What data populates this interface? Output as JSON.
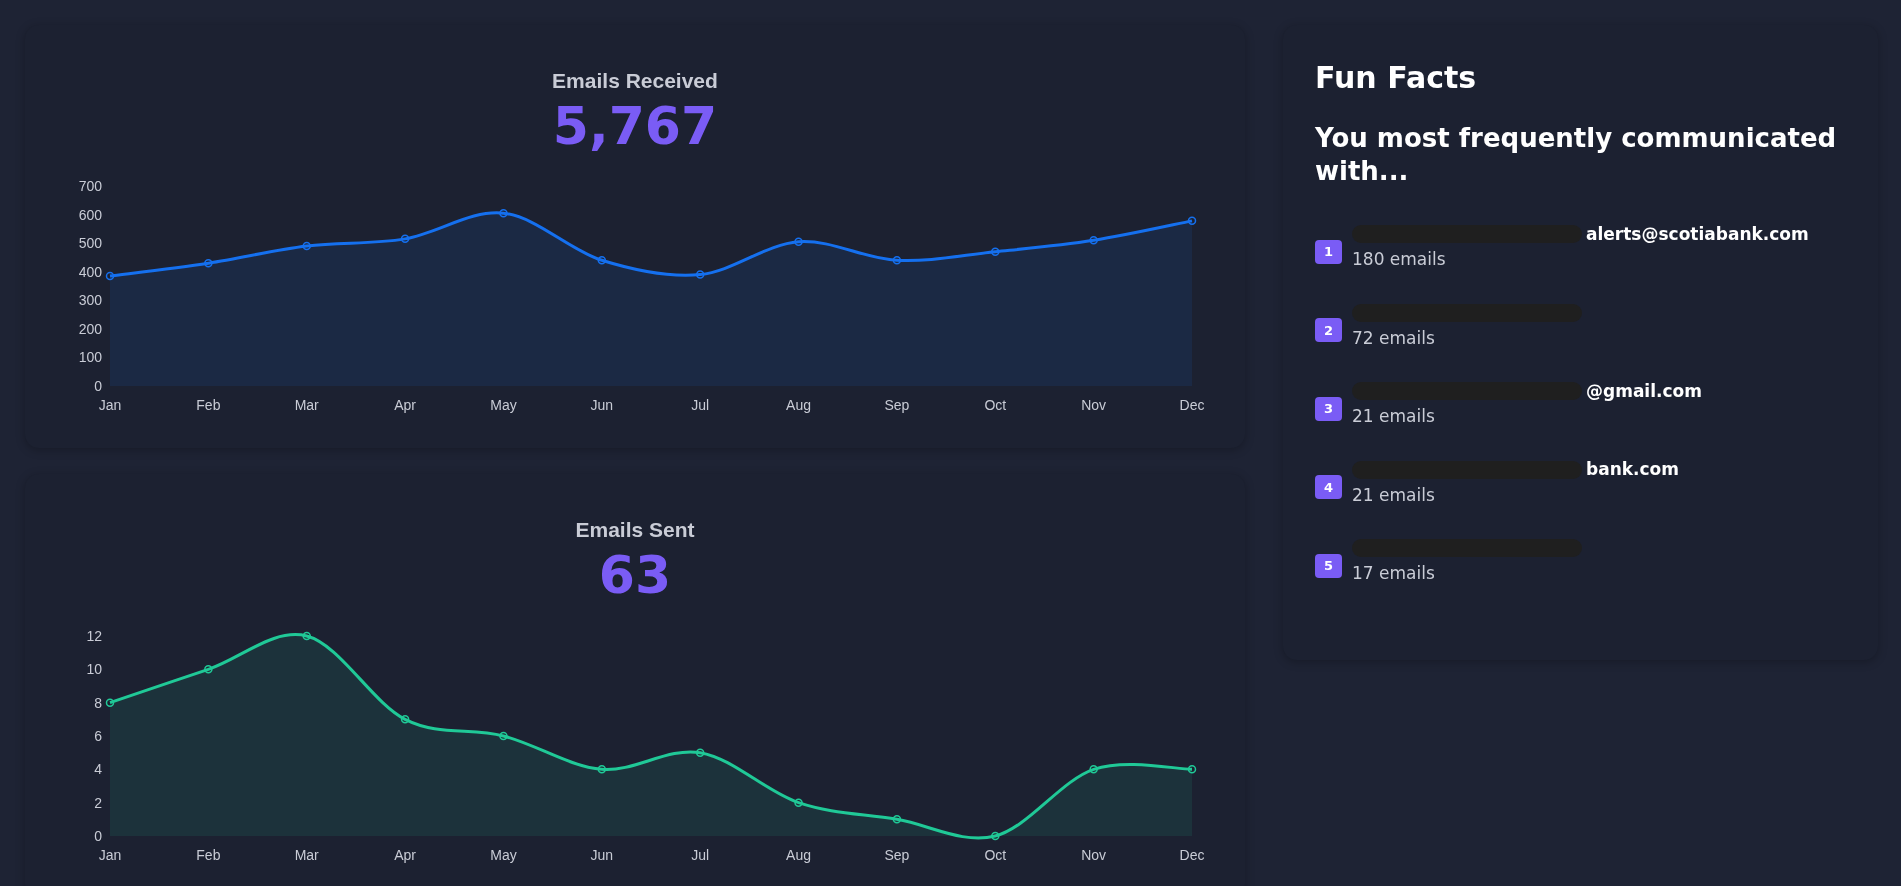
{
  "received": {
    "title": "Emails Received",
    "total": "5,767",
    "chart_data": {
      "type": "area",
      "categories": [
        "Jan",
        "Feb",
        "Mar",
        "Apr",
        "May",
        "Jun",
        "Jul",
        "Aug",
        "Sep",
        "Oct",
        "Nov",
        "Dec"
      ],
      "ylim": [
        0,
        700
      ],
      "yticks": [
        0,
        100,
        200,
        300,
        400,
        500,
        600,
        700
      ],
      "series": [
        {
          "color": "#1570ef",
          "values": [
            385,
            430,
            490,
            515,
            605,
            440,
            390,
            505,
            440,
            470,
            510,
            578
          ]
        }
      ]
    }
  },
  "sent": {
    "title": "Emails Sent",
    "total": "63",
    "chart_data": {
      "type": "area",
      "categories": [
        "Jan",
        "Feb",
        "Mar",
        "Apr",
        "May",
        "Jun",
        "Jul",
        "Aug",
        "Sep",
        "Oct",
        "Nov",
        "Dec"
      ],
      "ylim": [
        0,
        12
      ],
      "yticks": [
        0,
        2,
        4,
        6,
        8,
        10,
        12
      ],
      "series": [
        {
          "color": "#20c997",
          "values": [
            8,
            10,
            12,
            7,
            6,
            4,
            5,
            2,
            1,
            0,
            4,
            4
          ]
        }
      ]
    }
  },
  "fun_facts": {
    "title": "Fun Facts",
    "subtitle": "You most frequently communicated with...",
    "contacts": [
      {
        "rank": "1",
        "address": "alerts@scotiabank.com",
        "count": "180 emails",
        "redacted": true
      },
      {
        "rank": "2",
        "count": "72 emails",
        "redacted": true
      },
      {
        "rank": "3",
        "address": "@gmail.com",
        "count": "21 emails",
        "redacted": true
      },
      {
        "rank": "4",
        "address": "bank.com",
        "count": "21 emails",
        "redacted": true
      },
      {
        "rank": "5",
        "count": "17 emails",
        "redacted": true
      }
    ]
  }
}
